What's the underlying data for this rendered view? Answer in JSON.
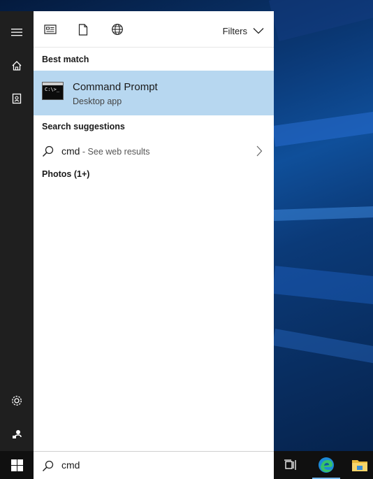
{
  "toolbar": {
    "icons": [
      "apps-icon",
      "document-icon",
      "web-icon"
    ],
    "filters_label": "Filters"
  },
  "sections": {
    "best_match": "Best match",
    "search_suggestions": "Search suggestions",
    "photos": "Photos (1+)"
  },
  "best_match": {
    "title": "Command Prompt",
    "subtitle": "Desktop app",
    "icon_text": "C:\\>_"
  },
  "suggestion": {
    "query": "cmd",
    "suffix": " - See web results"
  },
  "search": {
    "query": "cmd"
  },
  "rail": {
    "items": [
      "menu-icon",
      "home-icon",
      "documents-icon",
      "settings-icon",
      "account-icon"
    ]
  },
  "taskbar": {
    "items": [
      "start-button",
      "task-view-icon",
      "edge-icon",
      "file-explorer-icon"
    ]
  },
  "colors": {
    "selection": "#b7d7f0",
    "rail": "#1f1f1f",
    "taskbar": "#101010",
    "accent": "#76b9ed"
  }
}
